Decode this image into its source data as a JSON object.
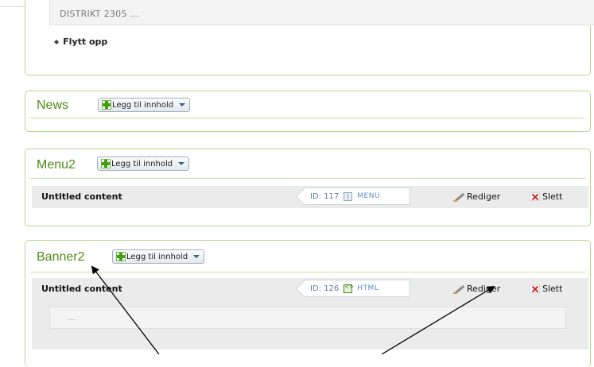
{
  "top_block": {
    "district_text": "DISTRIKT 2305 ...",
    "move_up_label": "Flytt opp"
  },
  "add_content_label": "Legg til innhold",
  "panels": [
    {
      "title": "News"
    },
    {
      "title": "Menu2",
      "content": {
        "title": "Untitled content",
        "id_text": "ID: 117",
        "type": "MENU",
        "edit_label": "Rediger",
        "delete_label": "Slett"
      }
    },
    {
      "title": "Banner2",
      "content": {
        "title": "Untitled content",
        "id_text": "ID: 126",
        "type": "HTML",
        "edit_label": "Rediger",
        "delete_label": "Slett",
        "body_text": "..."
      }
    }
  ],
  "colors": {
    "accent_green": "#4f8a19",
    "panel_border": "#b9d58f"
  },
  "icons": [
    "arrow-up-icon",
    "plus-icon",
    "caret-down-icon",
    "menu-type-icon",
    "html-type-icon",
    "pencil-icon",
    "delete-icon"
  ]
}
